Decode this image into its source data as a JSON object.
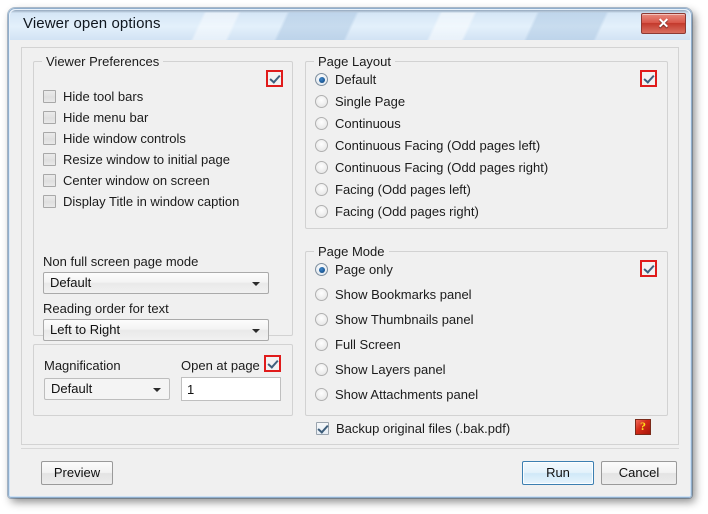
{
  "window": {
    "title": "Viewer open options",
    "close_label": "✕"
  },
  "viewer_preferences": {
    "title": "Viewer Preferences",
    "help_marker_name": "viewer-preferences-help-marker",
    "checkboxes": [
      {
        "label": "Hide tool bars",
        "checked": false
      },
      {
        "label": "Hide menu bar",
        "checked": false
      },
      {
        "label": "Hide window controls",
        "checked": false
      },
      {
        "label": "Resize window to initial page",
        "checked": false
      },
      {
        "label": "Center window on screen",
        "checked": false
      },
      {
        "label": "Display Title in window caption",
        "checked": false
      }
    ],
    "non_full_screen_label": "Non full screen page mode",
    "non_full_screen_value": "Default",
    "reading_order_label": "Reading order for text",
    "reading_order_value": "Left to Right"
  },
  "magnification_panel": {
    "magnification_label": "Magnification",
    "magnification_value": "Default",
    "open_at_page_label": "Open at page",
    "open_at_page_value": "1"
  },
  "page_layout": {
    "title": "Page Layout",
    "options": [
      {
        "label": "Default",
        "selected": true
      },
      {
        "label": "Single Page",
        "selected": false
      },
      {
        "label": "Continuous",
        "selected": false
      },
      {
        "label": "Continuous Facing (Odd pages left)",
        "selected": false
      },
      {
        "label": "Continuous Facing (Odd pages right)",
        "selected": false
      },
      {
        "label": "Facing (Odd pages left)",
        "selected": false
      },
      {
        "label": "Facing (Odd pages right)",
        "selected": false
      }
    ]
  },
  "page_mode": {
    "title": "Page Mode",
    "options": [
      {
        "label": "Page only",
        "selected": true
      },
      {
        "label": "Show Bookmarks panel",
        "selected": false
      },
      {
        "label": "Show Thumbnails panel",
        "selected": false
      },
      {
        "label": "Full Screen",
        "selected": false
      },
      {
        "label": "Show Layers panel",
        "selected": false
      },
      {
        "label": "Show Attachments panel",
        "selected": false
      }
    ]
  },
  "backup": {
    "label": "Backup original files (.bak.pdf)",
    "checked": true,
    "help_icon_label": "?"
  },
  "buttons": {
    "preview": "Preview",
    "run": "Run",
    "cancel": "Cancel"
  },
  "colors": {
    "titlebar_top": "#cfe1f3",
    "titlebar_bottom": "#d2e3f4",
    "close_button_red": "#d9574a",
    "default_button_border": "#3c7fb1",
    "help_marker_red": "#e01b1b",
    "radio_selected_blue": "#1f5f9e",
    "help_icon_bg": "#d42b18",
    "help_icon_glyph": "#ffe11a"
  }
}
